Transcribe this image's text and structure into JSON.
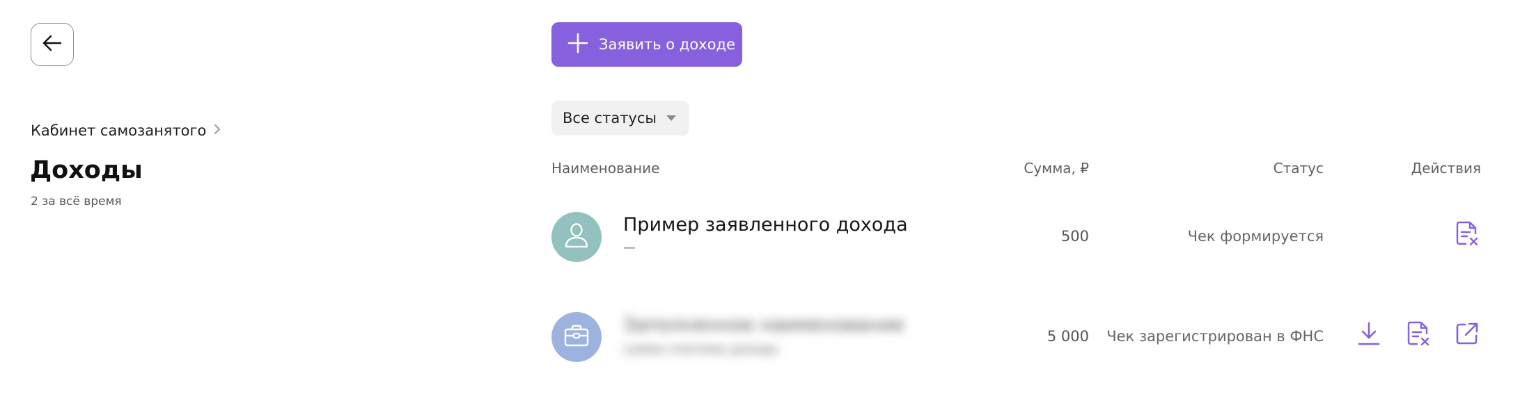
{
  "header": {
    "back_icon": "arrow-left-icon"
  },
  "breadcrumb": {
    "label": "Кабинет самозанятого"
  },
  "page": {
    "title": "Доходы",
    "subtitle": "2 за всё время"
  },
  "toolbar": {
    "add_income_label": "Заявить о доходе",
    "accent_color": "#8760de"
  },
  "filter": {
    "selected": "Все статусы"
  },
  "table": {
    "columns": {
      "name": "Наименование",
      "sum": "Сумма, ₽",
      "status": "Статус",
      "actions": "Действия"
    },
    "rows": [
      {
        "avatar_icon": "person-icon",
        "avatar_color": "#93c1bd",
        "name": "Пример заявленного дохода",
        "sub": "—",
        "sum": "500",
        "status": "Чек формируется",
        "actions": [
          "cancel-receipt-icon"
        ]
      },
      {
        "avatar_icon": "briefcase-icon",
        "avatar_color": "#9eb2e0",
        "name": "Заполненное наименование",
        "sub": "сумма платежа дохода",
        "sum": "5 000",
        "status": "Чек зарегистрирован в ФНС",
        "actions": [
          "download-icon",
          "cancel-receipt-icon",
          "external-link-icon"
        ]
      }
    ]
  }
}
